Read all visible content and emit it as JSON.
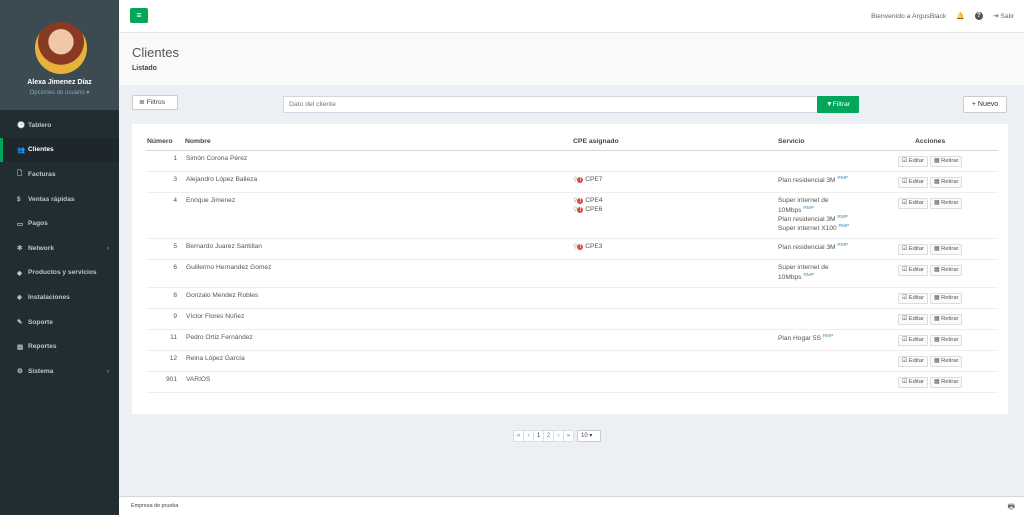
{
  "user": {
    "name": "Alexa Jimenez Díaz",
    "options_label": "Opciones de usuario ▾"
  },
  "menu": [
    {
      "icon": "🕒",
      "label": "Tablero",
      "chev": ""
    },
    {
      "icon": "👥",
      "label": "Clientes",
      "chev": ""
    },
    {
      "icon": "🗋",
      "label": "Facturas",
      "chev": ""
    },
    {
      "icon": "$",
      "label": "Ventas rápidas",
      "chev": ""
    },
    {
      "icon": "▭",
      "label": "Pagos",
      "chev": ""
    },
    {
      "icon": "✻",
      "label": "Network",
      "chev": "‹"
    },
    {
      "icon": "◆",
      "label": "Productos y servicios",
      "chev": ""
    },
    {
      "icon": "◈",
      "label": "Instalaciones",
      "chev": ""
    },
    {
      "icon": "✎",
      "label": "Soporte",
      "chev": ""
    },
    {
      "icon": "▤",
      "label": "Reportes",
      "chev": ""
    },
    {
      "icon": "⚙",
      "label": "Sistema",
      "chev": "‹"
    }
  ],
  "topbar": {
    "menu_icon": "≡",
    "welcome": "Bienvenido a ArgusBlack",
    "bell_icon": "🔔",
    "help_icon": "?",
    "logout_icon": "⇥",
    "logout": "Salir"
  },
  "header": {
    "title": "Clientes",
    "subtitle": "Listado"
  },
  "toolbar": {
    "filters_label": "≣ Filtros",
    "search_placeholder": "Dato del cliente",
    "filter_button": "▼Filtrar",
    "new_button": "+ Nuevo"
  },
  "table": {
    "headers": {
      "numero": "Número",
      "nombre": "Nombre",
      "cpe": "CPE asignado",
      "servicio": "Servicio",
      "acciones": "Acciones"
    },
    "edit_label": "☑ Editar",
    "remove_label": "▦ Retirar",
    "rows": [
      {
        "num": "1",
        "name": "Simón Corona Pérez",
        "cpe": [],
        "services": []
      },
      {
        "num": "3",
        "name": "Alejandro López Balleza",
        "cpe": [
          "CPE7"
        ],
        "services": [
          "Plan residencial 3M"
        ]
      },
      {
        "num": "4",
        "name": "Enrique Jimenez",
        "cpe": [
          "CPE4",
          "CPE6"
        ],
        "services": [
          "Super internet de",
          "10Mbps",
          "Plan residencial 3M",
          "Super internet X100"
        ]
      },
      {
        "num": "5",
        "name": "Bernardo Juarez Santillan",
        "cpe": [
          "CPE3"
        ],
        "services": [
          "Plan residencial 3M"
        ]
      },
      {
        "num": "6",
        "name": "Guillermo Hernandez Gomez",
        "cpe": [],
        "services": [
          "Super internet de",
          "10Mbps"
        ]
      },
      {
        "num": "8",
        "name": "Gonzalo Mendez Robles",
        "cpe": [],
        "services": []
      },
      {
        "num": "9",
        "name": "Víctor Flores Núñez",
        "cpe": [],
        "services": []
      },
      {
        "num": "11",
        "name": "Pedro Ortiz Fernández",
        "cpe": [],
        "services": [
          "Plan Hogar 5S"
        ]
      },
      {
        "num": "12",
        "name": "Reina López García",
        "cpe": [],
        "services": []
      },
      {
        "num": "901",
        "name": "VARIOS",
        "cpe": [],
        "services": []
      }
    ],
    "rmp": "RMP"
  },
  "pagination": {
    "first": "«",
    "prev": "‹",
    "pages": [
      "1",
      "2"
    ],
    "next": "›",
    "last": "»",
    "page_size": "10 ▾"
  },
  "footer": {
    "text": "Empresa de prueba",
    "icon": "🖶"
  },
  "colors": {
    "accent": "#00a65a",
    "sidebar": "#222d32",
    "link": "#3c8dbc",
    "danger": "#dd4b39"
  }
}
